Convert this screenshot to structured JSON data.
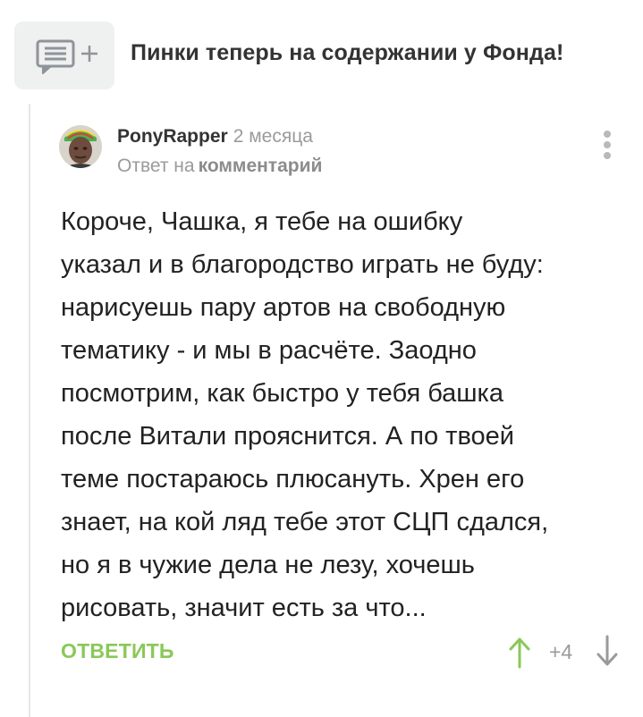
{
  "post": {
    "title": "Пинки теперь на содержании у Фонда!",
    "comment_button_icons": [
      "comment-icon",
      "plus-icon"
    ]
  },
  "comment": {
    "author": "PonyRapper",
    "time_ago": "2 месяца",
    "reply_prefix": "Ответ на",
    "reply_link": "комментарий",
    "body": "Короче, Чашка, я тебе на ошибку\nуказал и в благородство играть не буду:\nнарисуешь пару артов на свободную\nтематику - и мы в расчёте. Заодно\nпосмотрим, как быстро у тебя башка\nпосле Витали прояснится. А по твоей\nтеме постараюсь плюсануть. Хрен его\nзнает, на кой ляд тебе этот СЦП сдался,\nно я в чужие дела не лезу, хочешь\nрисовать, значит есть за что...",
    "reply_button_label": "ОТВЕТИТЬ",
    "rating": "+4",
    "icons": {
      "more": "more-vertical-icon",
      "upvote": "arrow-up-icon",
      "downvote": "arrow-down-icon"
    }
  },
  "colors": {
    "accent_green": "#8ac858",
    "muted_gray": "#9a9a9a",
    "button_background": "#eff0f0"
  }
}
